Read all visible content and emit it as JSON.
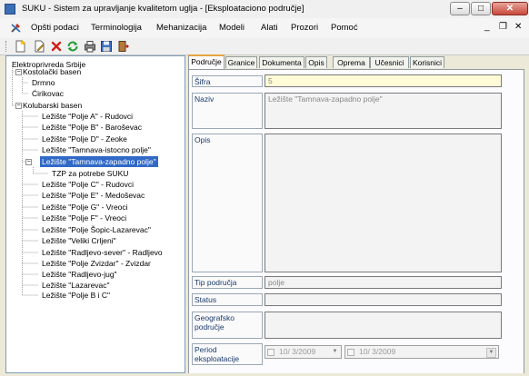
{
  "window": {
    "title": "SUKU - Sistem za upravljanje kvalitetom uglja - [Eksploataciono područje]",
    "minimize_glyph": "–",
    "maximize_glyph": "□",
    "close_glyph": "✕"
  },
  "menu": {
    "items": [
      "Opšti podaci",
      "Terminologija",
      "Mehanizacija",
      "Modeli",
      "Alati",
      "Prozori",
      "Pomoć"
    ],
    "mdi": {
      "minimize": "_",
      "restore": "❐",
      "close": "✕"
    }
  },
  "toolbar": {
    "buttons": [
      "new-icon",
      "edit-icon",
      "delete-icon",
      "refresh-icon",
      "print-icon",
      "save-icon",
      "exit-icon"
    ]
  },
  "tree": {
    "nodes": [
      {
        "label": "Elektroprivreda Srbije",
        "level": 0
      },
      {
        "label": "Kostolački basen",
        "level": 1,
        "toggle": "−"
      },
      {
        "label": "Drmno",
        "level": 2
      },
      {
        "label": "Ćirikovac",
        "level": 2
      },
      {
        "label": "Kolubarski basen",
        "level": 1,
        "toggle": "−"
      },
      {
        "label": "Ležište \"Polje A\" - Rudovci",
        "level": 2
      },
      {
        "label": "Ležište \"Polje B\" - Baroševac",
        "level": 2
      },
      {
        "label": "Ležište \"Polje D\" - Zeoke",
        "level": 2
      },
      {
        "label": "Ležište \"Tamnava-istocno polje\"",
        "level": 2
      },
      {
        "label": "Ležište \"Tamnava-zapadno polje\"",
        "level": 2,
        "toggle": "−",
        "selected": true
      },
      {
        "label": "TZP za potrebe SUKU",
        "level": 3
      },
      {
        "label": "Ležište \"Polje C\" - Rudovci",
        "level": 2
      },
      {
        "label": "Ležište \"Polje E\" - Medoševac",
        "level": 2
      },
      {
        "label": "Ležište \"Polje G\" - Vreoci",
        "level": 2
      },
      {
        "label": "Ležište \"Polje F\" - Vreoci",
        "level": 2
      },
      {
        "label": "Ležište \"Polje Šopic-Lazarevac\"",
        "level": 2
      },
      {
        "label": "Ležište \"Veliki Crljeni\"",
        "level": 2
      },
      {
        "label": "Ležište \"Radljevo-sever\" - Radljevo",
        "level": 2
      },
      {
        "label": "Ležište \"Polje Zvizdar\" - Zvizdar",
        "level": 2
      },
      {
        "label": "Ležište \"Radljevo-jug\"",
        "level": 2
      },
      {
        "label": "Ležište \"Lazarevac\"",
        "level": 2
      },
      {
        "label": "Ležište \"Polje B i C\"",
        "level": 2
      }
    ]
  },
  "tabs": [
    "Područje",
    "Granice",
    "Dokumenta",
    "Opis",
    "Oprema",
    "Učesnici",
    "Korisnici"
  ],
  "form": {
    "sifra_label": "Šifra",
    "sifra_value": "5",
    "naziv_label": "Naziv",
    "naziv_value": "Ležište \"Tamnava-zapadno polje\"",
    "opis_label": "Opis",
    "tip_label": "Tip područja",
    "tip_value": "polje",
    "status_label": "Status",
    "geo_label": "Geografsko područje",
    "period_label": "Period eksploatacije",
    "date_from": "10/  3/2009",
    "date_to": "10/  3/2009"
  },
  "colors": {
    "selection": "#3169c6",
    "active_tab_accent": "#e8a33c",
    "code_field": "#fffbd6"
  }
}
